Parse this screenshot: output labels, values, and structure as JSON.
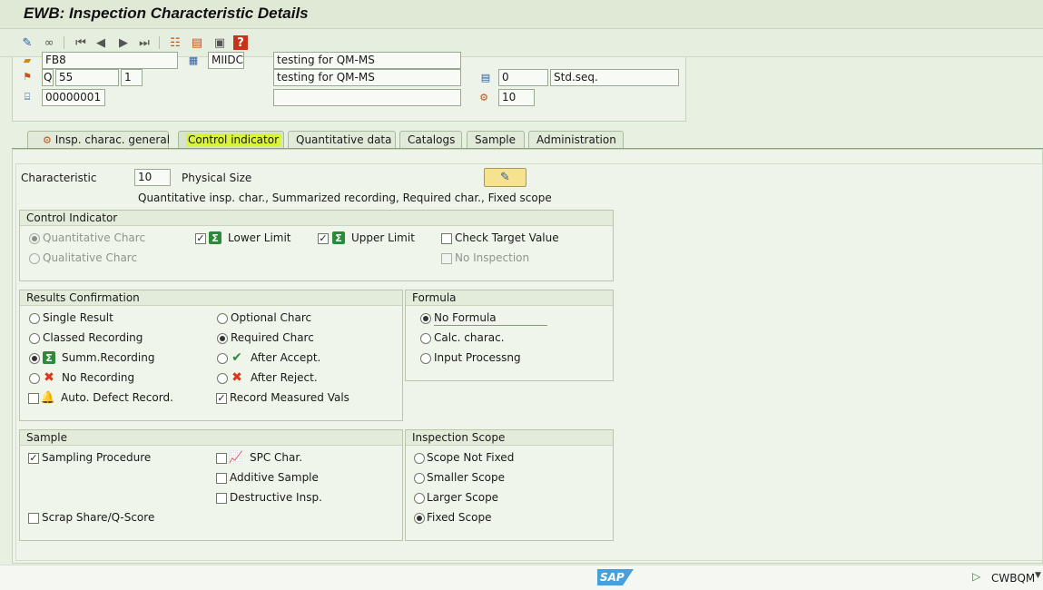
{
  "window": {
    "title": "EWB: Inspection Characteristic Details"
  },
  "toolbar": {
    "icons": [
      "pencil-icon",
      "glasses-icon",
      "first-icon",
      "prev-icon",
      "next-icon",
      "last-icon",
      "tree-icon",
      "stack-icon",
      "doc-icon",
      "help-icon"
    ]
  },
  "header": {
    "row0": {
      "field1": "FB8",
      "field2": "MIIDC",
      "desc": "testing for QM-MS"
    },
    "row1": {
      "prefix": "Q",
      "num": "55",
      "version": "1",
      "desc": "testing for QM-MS",
      "seq_num": "0",
      "seq_label": "Std.seq."
    },
    "row2": {
      "node": "00000001",
      "desc": "",
      "op_num": "10"
    }
  },
  "tabs": [
    {
      "label": "Insp. charac. general"
    },
    {
      "label": "Control indicator"
    },
    {
      "label": "Quantitative data"
    },
    {
      "label": "Catalogs"
    },
    {
      "label": "Sample"
    },
    {
      "label": "Administration"
    }
  ],
  "characteristic": {
    "label": "Characteristic",
    "value": "10",
    "name": "Physical Size",
    "summary": "Quantitative insp. char., Summarized recording, Required char., Fixed scope"
  },
  "control_indicator": {
    "title": "Control Indicator",
    "quantitative": "Quantitative Charc",
    "qualitative": "Qualitative Charc",
    "lower_limit": "Lower Limit",
    "upper_limit": "Upper Limit",
    "check_target": "Check Target Value",
    "no_inspection": "No Inspection"
  },
  "results": {
    "title": "Results Confirmation",
    "single": "Single Result",
    "classed": "Classed Recording",
    "summ": "Summ.Recording",
    "no_recording": "No Recording",
    "auto_defect": "Auto. Defect Record.",
    "optional": "Optional Charc",
    "required": "Required Charc",
    "after_accept": "After Accept.",
    "after_reject": "After Reject.",
    "record_measured": "Record Measured Vals"
  },
  "formula": {
    "title": "Formula",
    "no_formula": "No Formula",
    "calc": "Calc. charac.",
    "input": "Input Processng"
  },
  "sample": {
    "title": "Sample",
    "sampling": "Sampling Procedure",
    "spc": "SPC Char.",
    "additive": "Additive Sample",
    "destructive": "Destructive Insp.",
    "scrap": "Scrap Share/Q-Score"
  },
  "scope": {
    "title": "Inspection Scope",
    "not_fixed": "Scope Not Fixed",
    "smaller": "Smaller Scope",
    "larger": "Larger Scope",
    "fixed": "Fixed Scope"
  },
  "status": {
    "system": "CWBQM",
    "logo": "SAP"
  },
  "colors": {
    "highlight": "#d9f23a",
    "sap_blue": "#4a9fd6",
    "green_icon": "#2d8a3a",
    "red_icon": "#d9381e"
  }
}
